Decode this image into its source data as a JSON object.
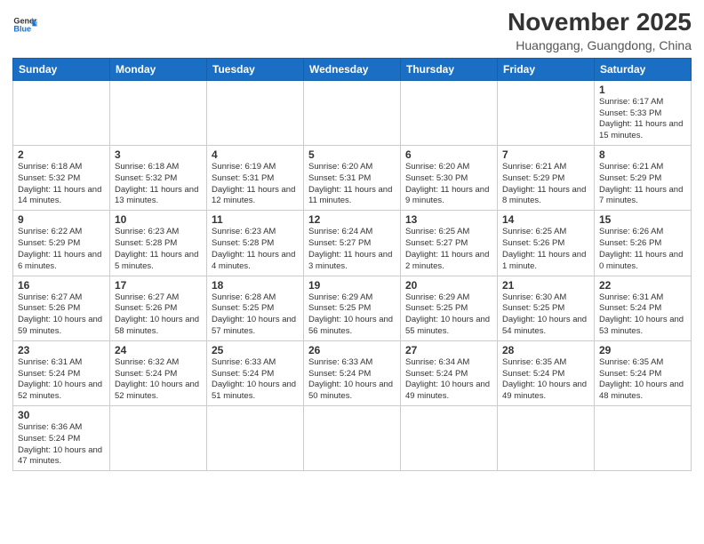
{
  "logo": {
    "text_general": "General",
    "text_blue": "Blue"
  },
  "title": "November 2025",
  "subtitle": "Huanggang, Guangdong, China",
  "weekdays": [
    "Sunday",
    "Monday",
    "Tuesday",
    "Wednesday",
    "Thursday",
    "Friday",
    "Saturday"
  ],
  "weeks": [
    [
      {
        "day": "",
        "info": ""
      },
      {
        "day": "",
        "info": ""
      },
      {
        "day": "",
        "info": ""
      },
      {
        "day": "",
        "info": ""
      },
      {
        "day": "",
        "info": ""
      },
      {
        "day": "",
        "info": ""
      },
      {
        "day": "1",
        "info": "Sunrise: 6:17 AM\nSunset: 5:33 PM\nDaylight: 11 hours\nand 15 minutes."
      }
    ],
    [
      {
        "day": "2",
        "info": "Sunrise: 6:18 AM\nSunset: 5:32 PM\nDaylight: 11 hours\nand 14 minutes."
      },
      {
        "day": "3",
        "info": "Sunrise: 6:18 AM\nSunset: 5:32 PM\nDaylight: 11 hours\nand 13 minutes."
      },
      {
        "day": "4",
        "info": "Sunrise: 6:19 AM\nSunset: 5:31 PM\nDaylight: 11 hours\nand 12 minutes."
      },
      {
        "day": "5",
        "info": "Sunrise: 6:20 AM\nSunset: 5:31 PM\nDaylight: 11 hours\nand 11 minutes."
      },
      {
        "day": "6",
        "info": "Sunrise: 6:20 AM\nSunset: 5:30 PM\nDaylight: 11 hours\nand 9 minutes."
      },
      {
        "day": "7",
        "info": "Sunrise: 6:21 AM\nSunset: 5:29 PM\nDaylight: 11 hours\nand 8 minutes."
      },
      {
        "day": "8",
        "info": "Sunrise: 6:21 AM\nSunset: 5:29 PM\nDaylight: 11 hours\nand 7 minutes."
      }
    ],
    [
      {
        "day": "9",
        "info": "Sunrise: 6:22 AM\nSunset: 5:29 PM\nDaylight: 11 hours\nand 6 minutes."
      },
      {
        "day": "10",
        "info": "Sunrise: 6:23 AM\nSunset: 5:28 PM\nDaylight: 11 hours\nand 5 minutes."
      },
      {
        "day": "11",
        "info": "Sunrise: 6:23 AM\nSunset: 5:28 PM\nDaylight: 11 hours\nand 4 minutes."
      },
      {
        "day": "12",
        "info": "Sunrise: 6:24 AM\nSunset: 5:27 PM\nDaylight: 11 hours\nand 3 minutes."
      },
      {
        "day": "13",
        "info": "Sunrise: 6:25 AM\nSunset: 5:27 PM\nDaylight: 11 hours\nand 2 minutes."
      },
      {
        "day": "14",
        "info": "Sunrise: 6:25 AM\nSunset: 5:26 PM\nDaylight: 11 hours\nand 1 minute."
      },
      {
        "day": "15",
        "info": "Sunrise: 6:26 AM\nSunset: 5:26 PM\nDaylight: 11 hours\nand 0 minutes."
      }
    ],
    [
      {
        "day": "16",
        "info": "Sunrise: 6:27 AM\nSunset: 5:26 PM\nDaylight: 10 hours\nand 59 minutes."
      },
      {
        "day": "17",
        "info": "Sunrise: 6:27 AM\nSunset: 5:26 PM\nDaylight: 10 hours\nand 58 minutes."
      },
      {
        "day": "18",
        "info": "Sunrise: 6:28 AM\nSunset: 5:25 PM\nDaylight: 10 hours\nand 57 minutes."
      },
      {
        "day": "19",
        "info": "Sunrise: 6:29 AM\nSunset: 5:25 PM\nDaylight: 10 hours\nand 56 minutes."
      },
      {
        "day": "20",
        "info": "Sunrise: 6:29 AM\nSunset: 5:25 PM\nDaylight: 10 hours\nand 55 minutes."
      },
      {
        "day": "21",
        "info": "Sunrise: 6:30 AM\nSunset: 5:25 PM\nDaylight: 10 hours\nand 54 minutes."
      },
      {
        "day": "22",
        "info": "Sunrise: 6:31 AM\nSunset: 5:24 PM\nDaylight: 10 hours\nand 53 minutes."
      }
    ],
    [
      {
        "day": "23",
        "info": "Sunrise: 6:31 AM\nSunset: 5:24 PM\nDaylight: 10 hours\nand 52 minutes."
      },
      {
        "day": "24",
        "info": "Sunrise: 6:32 AM\nSunset: 5:24 PM\nDaylight: 10 hours\nand 52 minutes."
      },
      {
        "day": "25",
        "info": "Sunrise: 6:33 AM\nSunset: 5:24 PM\nDaylight: 10 hours\nand 51 minutes."
      },
      {
        "day": "26",
        "info": "Sunrise: 6:33 AM\nSunset: 5:24 PM\nDaylight: 10 hours\nand 50 minutes."
      },
      {
        "day": "27",
        "info": "Sunrise: 6:34 AM\nSunset: 5:24 PM\nDaylight: 10 hours\nand 49 minutes."
      },
      {
        "day": "28",
        "info": "Sunrise: 6:35 AM\nSunset: 5:24 PM\nDaylight: 10 hours\nand 49 minutes."
      },
      {
        "day": "29",
        "info": "Sunrise: 6:35 AM\nSunset: 5:24 PM\nDaylight: 10 hours\nand 48 minutes."
      }
    ],
    [
      {
        "day": "30",
        "info": "Sunrise: 6:36 AM\nSunset: 5:24 PM\nDaylight: 10 hours\nand 47 minutes."
      },
      {
        "day": "",
        "info": ""
      },
      {
        "day": "",
        "info": ""
      },
      {
        "day": "",
        "info": ""
      },
      {
        "day": "",
        "info": ""
      },
      {
        "day": "",
        "info": ""
      },
      {
        "day": "",
        "info": ""
      }
    ]
  ]
}
